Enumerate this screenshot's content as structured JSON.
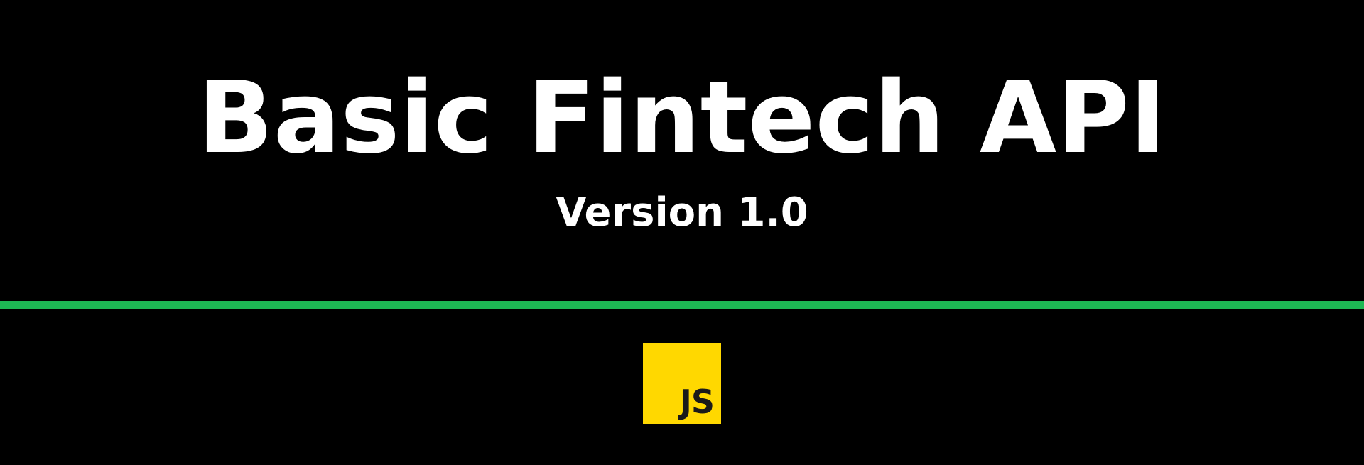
{
  "header": {
    "title": "Basic Fintech API",
    "version": "Version 1.0"
  },
  "logo": {
    "icon": "javascript-logo-icon",
    "text": "JS"
  },
  "colors": {
    "background": "#000000",
    "divider": "#1db954",
    "logo_background": "#ffd800",
    "logo_text": "#1a1a1a"
  }
}
